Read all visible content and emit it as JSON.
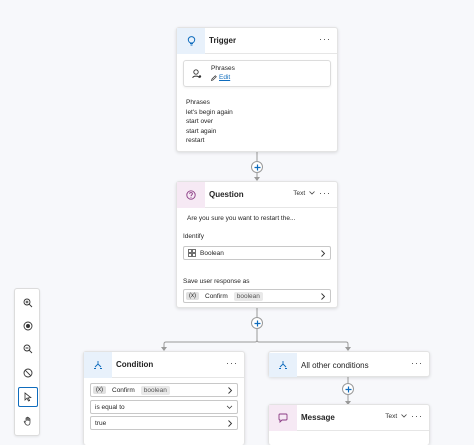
{
  "trigger": {
    "title": "Trigger",
    "inner_title": "Phrases",
    "edit_label": "Edit",
    "list_title": "Phrases",
    "phrases": [
      "let's begin again",
      "start over",
      "start again",
      "restart"
    ]
  },
  "question": {
    "title": "Question",
    "type_label": "Text",
    "prompt": "Are you sure you want to restart the...",
    "identify_label": "Identify",
    "identify_value": "Boolean",
    "save_label": "Save user response as",
    "var_tag": "(x)",
    "var_name": "Confirm",
    "var_type": "boolean"
  },
  "condition": {
    "title": "Condition",
    "var_tag": "(x)",
    "var_name": "Confirm",
    "var_type": "boolean",
    "operator": "is equal to",
    "value": "true"
  },
  "other": {
    "title": "All other conditions"
  },
  "message": {
    "title": "Message",
    "type_label": "Text"
  },
  "colors": {
    "accent": "#0f6cbd",
    "trigger_icon_bg": "#e8f1fb",
    "question_icon_bg": "#f6e9f4",
    "condition_icon_bg": "#e8f1fb"
  },
  "toolbar_icons": [
    "zoom-in-icon",
    "recenter-icon",
    "zoom-out-icon",
    "minimap-icon",
    "select-icon",
    "pan-hand-icon"
  ]
}
